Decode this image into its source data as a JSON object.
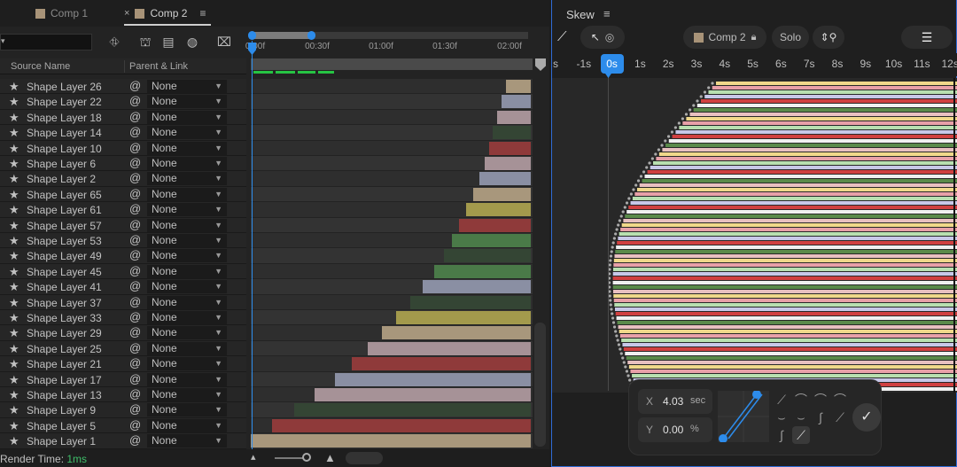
{
  "tabs": [
    {
      "label": "Comp 1",
      "active": false
    },
    {
      "label": "Comp 2",
      "active": true
    }
  ],
  "timeline": {
    "ruler_ticks": [
      "0:00f",
      "00:30f",
      "01:00f",
      "01:30f",
      "02:00f"
    ],
    "columns": {
      "source_name": "Source Name",
      "parent_link": "Parent & Link"
    },
    "layers": [
      {
        "name": "Shape Layer 26",
        "parent": "None",
        "color": "#a8977c",
        "start": 0.905
      },
      {
        "name": "Shape Layer 22",
        "parent": "None",
        "color": "#8a8fa3",
        "start": 0.89
      },
      {
        "name": "Shape Layer 18",
        "parent": "None",
        "color": "#a69297",
        "start": 0.875
      },
      {
        "name": "Shape Layer 14",
        "parent": "None",
        "color": "#344534",
        "start": 0.86
      },
      {
        "name": "Shape Layer 10",
        "parent": "None",
        "color": "#8f3a3a",
        "start": 0.845
      },
      {
        "name": "Shape Layer 6",
        "parent": "None",
        "color": "#a69297",
        "start": 0.83
      },
      {
        "name": "Shape Layer 2",
        "parent": "None",
        "color": "#8a8fa3",
        "start": 0.81
      },
      {
        "name": "Shape Layer 65",
        "parent": "None",
        "color": "#a8977c",
        "start": 0.79
      },
      {
        "name": "Shape Layer 61",
        "parent": "None",
        "color": "#a39a4c",
        "start": 0.765
      },
      {
        "name": "Shape Layer 57",
        "parent": "None",
        "color": "#8f3a3a",
        "start": 0.74
      },
      {
        "name": "Shape Layer 53",
        "parent": "None",
        "color": "#4a7a48",
        "start": 0.715
      },
      {
        "name": "Shape Layer 49",
        "parent": "None",
        "color": "#344534",
        "start": 0.685
      },
      {
        "name": "Shape Layer 45",
        "parent": "None",
        "color": "#4a7a48",
        "start": 0.65
      },
      {
        "name": "Shape Layer 41",
        "parent": "None",
        "color": "#8a8fa3",
        "start": 0.61
      },
      {
        "name": "Shape Layer 37",
        "parent": "None",
        "color": "#344534",
        "start": 0.565
      },
      {
        "name": "Shape Layer 33",
        "parent": "None",
        "color": "#a39a4c",
        "start": 0.515
      },
      {
        "name": "Shape Layer 29",
        "parent": "None",
        "color": "#a8977c",
        "start": 0.465
      },
      {
        "name": "Shape Layer 25",
        "parent": "None",
        "color": "#a69297",
        "start": 0.415
      },
      {
        "name": "Shape Layer 21",
        "parent": "None",
        "color": "#8f3a3a",
        "start": 0.36
      },
      {
        "name": "Shape Layer 17",
        "parent": "None",
        "color": "#8a8fa3",
        "start": 0.3
      },
      {
        "name": "Shape Layer 13",
        "parent": "None",
        "color": "#a69297",
        "start": 0.225
      },
      {
        "name": "Shape Layer 9",
        "parent": "None",
        "color": "#344534",
        "start": 0.155
      },
      {
        "name": "Shape Layer 5",
        "parent": "None",
        "color": "#8f3a3a",
        "start": 0.075
      },
      {
        "name": "Shape Layer 1",
        "parent": "None",
        "color": "#a8977c",
        "start": 0.0
      }
    ],
    "render_time_label": "Render Time:",
    "render_time_value": "1ms"
  },
  "skew": {
    "title": "Skew",
    "comp_label": "Comp 2",
    "solo_label": "Solo",
    "seconds": [
      "s",
      "-1s",
      "0s",
      "1s",
      "2s",
      "3s",
      "4s",
      "5s",
      "6s",
      "7s",
      "8s",
      "9s",
      "10s",
      "11s",
      "12s"
    ],
    "x_label": "X",
    "x_value": "4.03",
    "x_unit": "sec",
    "y_label": "Y",
    "y_value": "0.00",
    "y_unit": "%",
    "bar_colors": [
      "#f0d88a",
      "#e8a0a8",
      "#b8e0b0",
      "#c8c8e8",
      "#d04040",
      "#f0f0f0",
      "#5a8a4a",
      "#e8c0c0"
    ]
  }
}
